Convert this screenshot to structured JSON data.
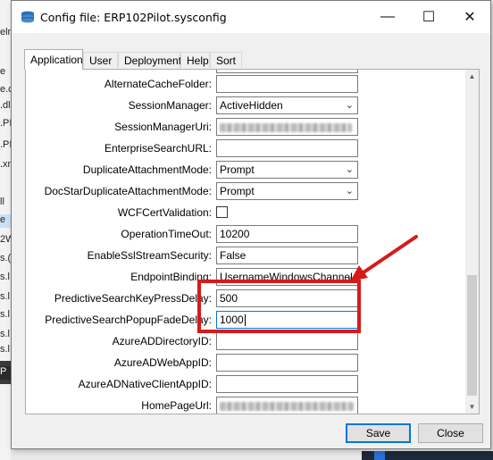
{
  "window": {
    "title": "Config file: ERP102Pilot.sysconfig",
    "minimize_symbol": "—",
    "maximize_symbol": "☐",
    "close_symbol": "✕"
  },
  "tabs": [
    {
      "label": "Application",
      "active": true
    },
    {
      "label": "User",
      "active": false
    },
    {
      "label": "Deployment",
      "active": false
    },
    {
      "label": "Help",
      "active": false
    },
    {
      "label": "Sort",
      "active": false
    }
  ],
  "fields": [
    {
      "label": "AlternateCacheFolder:",
      "value": "",
      "type": "text"
    },
    {
      "label": "SessionManager:",
      "value": "ActiveHidden",
      "type": "dropdown"
    },
    {
      "label": "SessionManagerUri:",
      "value": "",
      "type": "text-obscured"
    },
    {
      "label": "EnterpriseSearchURL:",
      "value": "",
      "type": "text"
    },
    {
      "label": "DuplicateAttachmentMode:",
      "value": "Prompt",
      "type": "dropdown"
    },
    {
      "label": "DocStarDuplicateAttachmentMode:",
      "value": "Prompt",
      "type": "dropdown"
    },
    {
      "label": "WCFCertValidation:",
      "value": "",
      "type": "checkbox",
      "checked": false
    },
    {
      "label": "OperationTimeOut:",
      "value": "10200",
      "type": "text"
    },
    {
      "label": "EnableSslStreamSecurity:",
      "value": "False",
      "type": "text"
    },
    {
      "label": "EndpointBinding:",
      "value": "UsernameWindowsChannel",
      "type": "dropdown"
    },
    {
      "label": "PredictiveSearchKeyPressDelay:",
      "value": "500",
      "type": "text"
    },
    {
      "label": "PredictiveSearchPopupFadeDelay:",
      "value": "1000",
      "type": "text"
    },
    {
      "label": "AzureADDirectoryID:",
      "value": "",
      "type": "text"
    },
    {
      "label": "AzureADWebAppID:",
      "value": "",
      "type": "text"
    },
    {
      "label": "AzureADNativeClientAppID:",
      "value": "",
      "type": "text"
    },
    {
      "label": "HomePageUrl:",
      "value": "",
      "type": "text-obscured"
    }
  ],
  "buttons": {
    "save": "Save",
    "close": "Close"
  },
  "background_items": [
    "eln",
    "e",
    "e.c",
    ".dl",
    ".PI",
    ".PI",
    ".xn",
    "ll",
    "e",
    "2W",
    "s.(",
    "s.l",
    "s.l",
    "s.l",
    "s.l",
    "s.l",
    "P"
  ],
  "colors": {
    "highlight": "#d71a1a",
    "focus_border": "#0078d7"
  },
  "icons": {
    "app": "stacked-layers-icon",
    "dropdown": "chevron-down-icon"
  }
}
